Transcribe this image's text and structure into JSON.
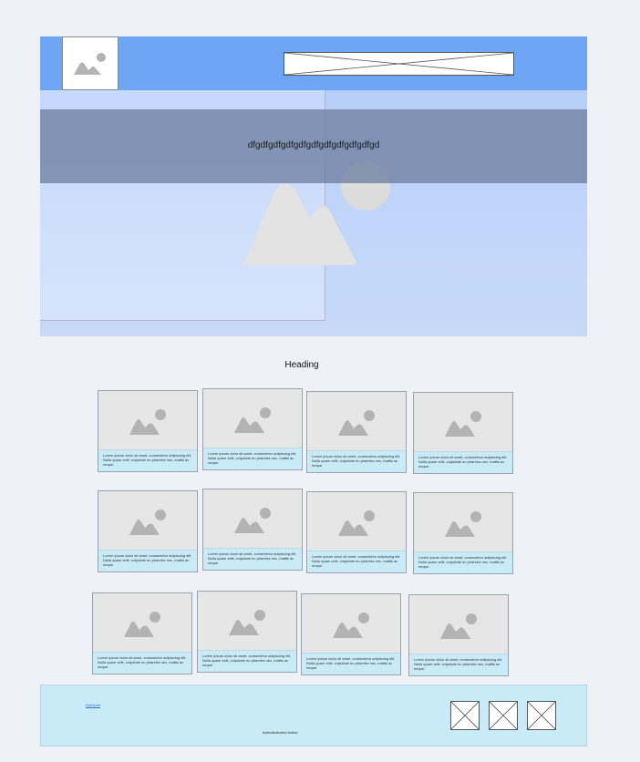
{
  "hero": {
    "overlay_text": "dfgdfgdfgdfgdfgdfgdfgdfgdfgdfgd"
  },
  "section": {
    "heading": "Heading"
  },
  "cards": [
    {
      "caption": "Lorem ipsum dolor sit amet, consectetur adipiscing elit. Nulla quam velit, vulputate eu pharetra nec, mattis ac neque."
    },
    {
      "caption": "Lorem ipsum dolor sit amet, consectetur adipiscing elit. Nulla quam velit, vulputate eu pharetra nec, mattis ac neque."
    },
    {
      "caption": "Lorem ipsum dolor sit amet, consectetur adipiscing elit. Nulla quam velit, vulputate eu pharetra nec, mattis ac neque."
    },
    {
      "caption": "Lorem ipsum dolor sit amet, consectetur adipiscing elit. Nulla quam velit, vulputate eu pharetra nec, mattis ac neque."
    },
    {
      "caption": "Lorem ipsum dolor sit amet, consectetur adipiscing elit. Nulla quam velit, vulputate eu pharetra nec, mattis ac neque."
    },
    {
      "caption": "Lorem ipsum dolor sit amet, consectetur adipiscing elit. Nulla quam velit, vulputate eu pharetra nec, mattis ac neque."
    },
    {
      "caption": "Lorem ipsum dolor sit amet, consectetur adipiscing elit. Nulla quam velit, vulputate eu pharetra nec, mattis ac neque."
    },
    {
      "caption": "Lorem ipsum dolor sit amet, consectetur adipiscing elit. Nulla quam velit, vulputate eu pharetra nec, mattis ac neque."
    },
    {
      "caption": "Lorem ipsum dolor sit amet, consectetur adipiscing elit. Nulla quam velit, vulputate eu pharetra nec, mattis ac neque."
    },
    {
      "caption": "Lorem ipsum dolor sit amet, consectetur adipiscing elit. Nulla quam velit, vulputate eu pharetra nec, mattis ac neque."
    },
    {
      "caption": "Lorem ipsum dolor sit amet, consectetur adipiscing elit. Nulla quam velit, vulputate eu pharetra nec, mattis ac neque."
    },
    {
      "caption": "Lorem ipsum dolor sit amet, consectetur adipiscing elit. Nulla quam velit, vulputate eu pharetra nec, mattis ac neque."
    }
  ],
  "footer": {
    "link_text": "fdsfdsdsf",
    "text": "fsdfsdfsdfsdfsd fsdfsd"
  },
  "colors": {
    "header_bg": "#6ea6f5",
    "hero_band": "#6e80a0",
    "card_caption_bg": "#c9ebf8",
    "footer_bg": "#c9ebf8",
    "placeholder_gray": "#b3b3b3"
  },
  "icons": {
    "logo": "image-placeholder-icon",
    "card_image": "image-placeholder-icon",
    "social": "x-placeholder-icon"
  }
}
